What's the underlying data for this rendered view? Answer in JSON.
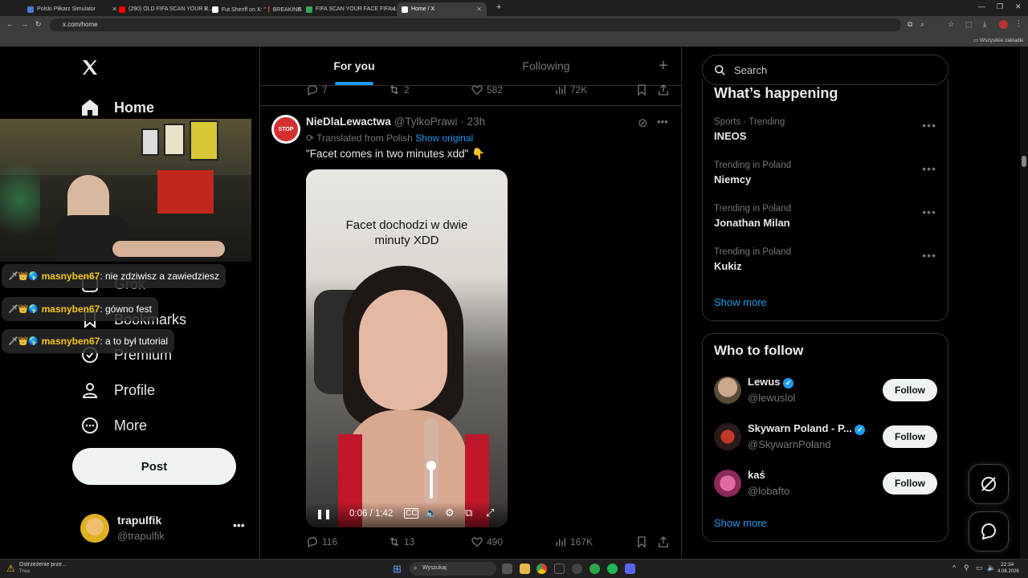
{
  "browser": {
    "tabs": [
      {
        "label": "Polski Piłkarz Simulator",
        "color": "#4a7bd4"
      },
      {
        "label": "(290) OLD FIFA SCAN YOUR F...",
        "color": "#ff0000"
      },
      {
        "label": "Fut Sheriff on X: \"❗BREAKING",
        "color": "#ffffff"
      },
      {
        "label": "FIFA SCAN YOUR FACE FIFA 14",
        "color": "#34a853"
      },
      {
        "label": "Home / X",
        "color": "#ffffff"
      }
    ],
    "url": "x.com/home",
    "bookmarks_label": "Wszystkie zakładki"
  },
  "nav": {
    "home": "Home",
    "grok": "Grok",
    "bookmarks": "Bookmarks",
    "premium": "Premium",
    "profile": "Profile",
    "more": "More",
    "post_button": "Post",
    "account_name": "trapulfik",
    "account_handle": "@trapulfik"
  },
  "chat": [
    {
      "user": "masnyben67",
      "message": ": nie zdziwisz a zawiedziesz"
    },
    {
      "user": "masnyben67",
      "message": ": gówno fest"
    },
    {
      "user": "masnyben67",
      "message": ": a to był tutorial"
    }
  ],
  "timeline": {
    "tab_for_you": "For you",
    "tab_following": "Following",
    "prev_post_actions": {
      "replies": "7",
      "reposts": "2",
      "likes": "582",
      "views": "72K"
    },
    "post": {
      "author": "NieDlaLewactwa",
      "handle": "@TylkoPrawi",
      "time": "· 23h",
      "translated_label": "Translated from Polish",
      "show_original": "Show original",
      "text": "\"Facet comes in two minutes xdd\" 👇",
      "video_caption": "Facet dochodzi w dwie minuty XDD",
      "video_time": "0:06 / 1:42",
      "video_volume": 0.45,
      "replies": "116",
      "reposts": "13",
      "likes": "490",
      "views": "167K"
    }
  },
  "right": {
    "search_placeholder": "Search",
    "whats_happening_title": "What’s happening",
    "trends": [
      {
        "meta": "Sports · Trending",
        "name": "INEOS"
      },
      {
        "meta": "Trending in Poland",
        "name": "Niemcy"
      },
      {
        "meta": "Trending in Poland",
        "name": "Jonathan Milan"
      },
      {
        "meta": "Trending in Poland",
        "name": "Kukiz"
      }
    ],
    "show_more": "Show more",
    "who_to_follow_title": "Who to follow",
    "follow_suggestions": [
      {
        "name": "Lewus",
        "handle": "@lewuslol",
        "verified": true
      },
      {
        "name": "Skywarn Poland - P...",
        "handle": "@SkywarnPoland",
        "verified": true
      },
      {
        "name": "kaś",
        "handle": "@lobafto",
        "verified": false
      }
    ],
    "follow_label": "Follow",
    "show_more_follow": "Show more"
  },
  "taskbar": {
    "weather_title": "Ostrzeżenie prze...",
    "weather_sub": "Trwa",
    "search_label": "Wyszukaj",
    "time": "22:34",
    "date": "4.08.2026"
  },
  "colors": {
    "accent": "#1d9bf0",
    "bg": "#000000",
    "border": "#2f3336",
    "muted": "#71767b"
  }
}
